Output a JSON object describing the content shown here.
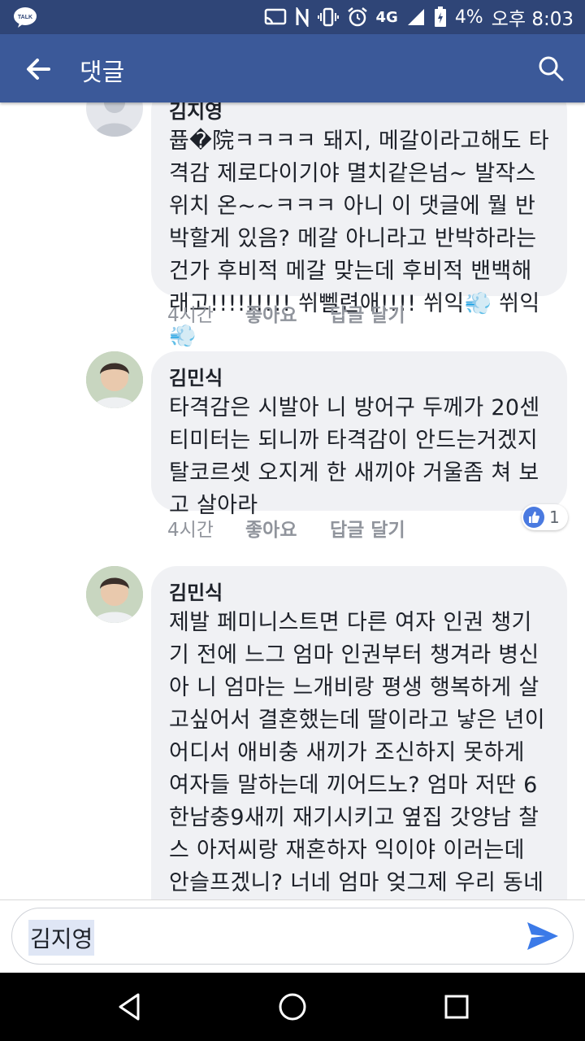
{
  "status_bar": {
    "kakao_label": "TALK",
    "network": "4G",
    "battery": "4%",
    "time": "오후 8:03"
  },
  "app_bar": {
    "title": "댓글",
    "back_icon": "arrow-left-icon",
    "search_icon": "search-icon"
  },
  "comments": [
    {
      "author": "김지영",
      "text": "퓹�院ㅋㅋㅋㅋ 돼지, 메갈이라고해도 타격감 제로다이기야 멸치같은넘~ 발작스위치 온~~ㅋㅋㅋ 아니 이 댓글에 뭘 반박할게 있음? 메갈 아니라고 반박하라는건가 후비적 메갈 맞는데 후비적 밴백해래고!!!!!!!!! 쒸뻴련애!!!! 쒸익💨 쒸익💨",
      "time": "4시간",
      "like": "좋아요",
      "reply": "답글 달기"
    },
    {
      "author": "김민식",
      "text": "타격감은 시발아 니 방어구 두께가 20센티미터는 되니까 타격감이 안드는거겠지 탈코르셋 오지게 한 새끼야 거울좀 쳐 보고 살아라",
      "time": "4시간",
      "like": "좋아요",
      "reply": "답글 달기",
      "reactions": "1"
    },
    {
      "author": "김민식",
      "text": "제발 페미니스트면 다른 여자 인권 챙기기 전에 느그 엄마 인권부터 챙겨라 병신아 니 엄마는 느개비랑 평생 행복하게 살고싶어서 결혼했는데 딸이라고 낳은 년이 어디서 애비충 새끼가 조신하지 못하게 여자들 말하는데 끼어드노? 엄마 저딴 6한남충9새끼 재기시키고 옆집 갓양남 찰스 아저씨랑 재혼하자 익이야 이러는데 안슬프겠니? 너네 엄마 엊그제 우리 동네 편의점에서 혼자 소주 까시더라 썅년아 정신좀 차려"
    }
  ],
  "input": {
    "value": "김지영",
    "send_icon": "send-icon"
  },
  "nav": {
    "back": "nav-back-icon",
    "home": "nav-home-icon",
    "recents": "nav-recents-icon"
  }
}
